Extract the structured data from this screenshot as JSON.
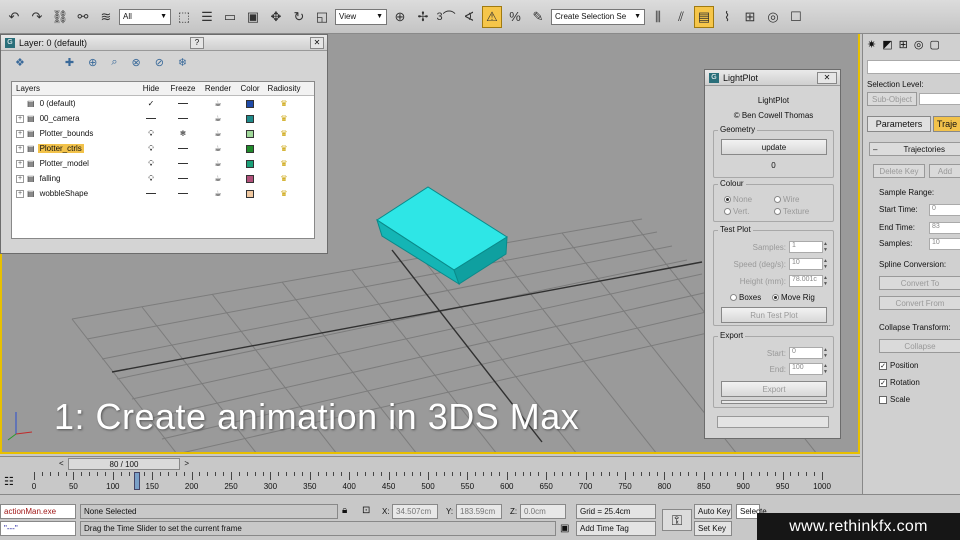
{
  "toolbar": {
    "filter_select": "All",
    "view_select": "View",
    "selection_set_select": "Create Selection Se",
    "snap_label": "3"
  },
  "viewport": {
    "caption": "1: Create animation in 3DS Max"
  },
  "layer_window": {
    "title": "Layer: 0 (default)",
    "help_button": "?",
    "headers": [
      "Layers",
      "Hide",
      "Freeze",
      "Render",
      "Color",
      "Radiosity"
    ],
    "rows": [
      {
        "name": "0 (default)",
        "color": "#1e4aa8",
        "expander": false,
        "hide": "dash",
        "freeze": "dash",
        "current": true,
        "selected": false
      },
      {
        "name": "00_camera",
        "color": "#1e8a8a",
        "expander": true,
        "hide": "dash",
        "freeze": "dash",
        "current": false,
        "selected": false
      },
      {
        "name": "Plotter_bounds",
        "color": "#a0d89a",
        "expander": true,
        "hide": "bulb",
        "freeze": "snow",
        "current": false,
        "selected": false
      },
      {
        "name": "Plotter_ctrls",
        "color": "#1f8a2a",
        "expander": true,
        "hide": "bulb",
        "freeze": "dash",
        "current": false,
        "selected": true
      },
      {
        "name": "Plotter_model",
        "color": "#1aa078",
        "expander": true,
        "hide": "bulb",
        "freeze": "dash",
        "current": false,
        "selected": false
      },
      {
        "name": "falling",
        "color": "#b0507a",
        "expander": true,
        "hide": "bulb",
        "freeze": "dash",
        "current": false,
        "selected": false
      },
      {
        "name": "wobbleShape",
        "color": "#f0c8a0",
        "expander": true,
        "hide": "dash",
        "freeze": "dash",
        "current": false,
        "selected": false
      }
    ]
  },
  "lightplot": {
    "window_title": "LightPlot",
    "close_button": "✕",
    "heading": "LightPlot",
    "author": "© Ben Cowell Thomas",
    "geometry": {
      "title": "Geometry",
      "update_label": "update",
      "count": "0"
    },
    "colour": {
      "title": "Colour",
      "options": [
        "None",
        "Wire",
        "Vert.",
        "Texture"
      ]
    },
    "test_plot": {
      "title": "Test Plot",
      "samples_label": "Samples:",
      "samples_value": "1",
      "speed_label": "Speed (deg/s):",
      "speed_value": "10",
      "height_label": "Height (mm):",
      "height_value": "78.001c",
      "radio_boxes": "Boxes",
      "radio_move_rig": "Move Rig",
      "run_label": "Run Test Plot"
    },
    "export": {
      "title": "Export",
      "start_label": "Start:",
      "start_value": "0",
      "end_label": "End:",
      "end_value": "100",
      "export_label": "Export"
    }
  },
  "command_panel": {
    "selection_level_label": "Selection Level:",
    "sub_object_label": "Sub-Object",
    "tab_parameters": "Parameters",
    "tab_trajectories": "Traje",
    "rollout_title": "Trajectories",
    "delete_key_label": "Delete Key",
    "add_key_label": "Add",
    "sample_range_label": "Sample Range:",
    "start_time_label": "Start Time:",
    "start_time_value": "0",
    "end_time_label": "End Time:",
    "end_time_value": "83",
    "samples_label": "Samples:",
    "samples_value": "10",
    "spline_conversion_label": "Spline Conversion:",
    "convert_to_label": "Convert To",
    "convert_from_label": "Convert From",
    "collapse_transform_label": "Collapse Transform:",
    "collapse_label": "Collapse",
    "chk_position": "Position",
    "chk_position_on": true,
    "chk_rotation": "Rotation",
    "chk_rotation_on": true,
    "chk_scale": "Scale",
    "chk_scale_on": false
  },
  "timeline": {
    "slider_label": "80 / 100",
    "prev_arrow": "<",
    "next_arrow": ">",
    "current_frame": 80,
    "total_frames": 100,
    "tick_labels": [
      "0",
      "50",
      "100",
      "150",
      "200",
      "250",
      "300",
      "350",
      "400",
      "450",
      "500",
      "550",
      "600",
      "650",
      "700",
      "750",
      "800",
      "850",
      "900",
      "950",
      "1000"
    ]
  },
  "status": {
    "script_listener_label": "actionMan.exe",
    "script_listener_value": "\"---\"",
    "selection_status": "None Selected",
    "prompt": "Drag the Time Slider to set the current frame",
    "x_label": "X:",
    "x_value": "34.507cm",
    "y_label": "Y:",
    "y_value": "183.59cm",
    "z_label": "Z:",
    "z_value": "0.0cm",
    "grid_label": "Grid = 25.4cm",
    "add_time_tag_label": "Add Time Tag",
    "auto_key_label": "Auto Key",
    "set_key_label": "Set Key",
    "selected_select": "Selecte",
    "watermark": "www.rethinkfx.com"
  }
}
